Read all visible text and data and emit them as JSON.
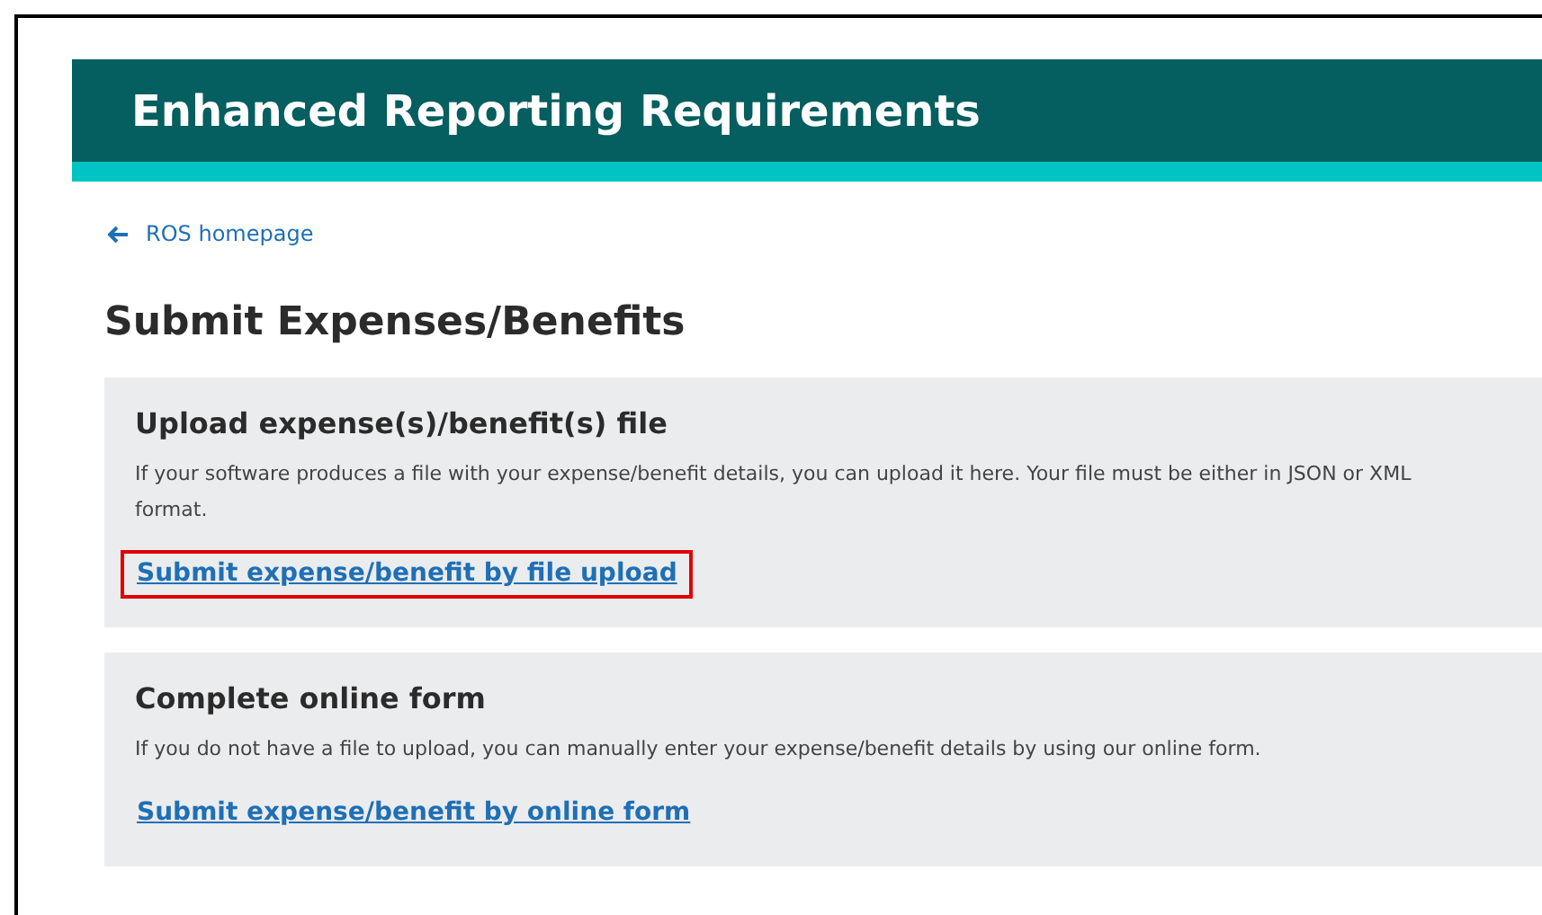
{
  "header": {
    "title": "Enhanced Reporting Requirements"
  },
  "back_link": {
    "label": "ROS homepage"
  },
  "heading": "Submit Expenses/Benefits",
  "cards": [
    {
      "title": "Upload expense(s)/benefit(s) file",
      "text": "If your software produces a file with your expense/benefit details, you can upload it here. Your file must be either in JSON or XML format.",
      "link": {
        "label": "Submit expense/benefit by file upload",
        "highlighted": true
      }
    },
    {
      "title": "Complete online form",
      "text": "If you do not have a file to upload, you can manually enter your expense/benefit details by using our online form.",
      "link": {
        "label": "Submit expense/benefit by online form",
        "highlighted": false
      }
    }
  ]
}
